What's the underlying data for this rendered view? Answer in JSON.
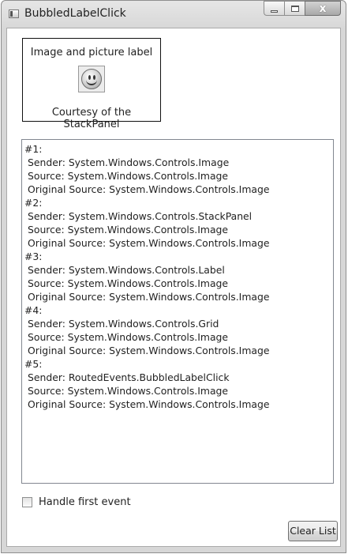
{
  "window": {
    "title": "BubbledLabelClick",
    "close_glyph": "x"
  },
  "label": {
    "top_text": "Image and picture label",
    "bottom_text": "Courtesy of the StackPanel",
    "image_icon": "smiley-face-icon"
  },
  "event_list": {
    "entries": [
      {
        "header": "#1:",
        "sender": "Sender: System.Windows.Controls.Image",
        "source": "Source: System.Windows.Controls.Image",
        "original_source": "Original Source: System.Windows.Controls.Image"
      },
      {
        "header": "#2:",
        "sender": "Sender: System.Windows.Controls.StackPanel",
        "source": "Source: System.Windows.Controls.Image",
        "original_source": "Original Source: System.Windows.Controls.Image"
      },
      {
        "header": "#3:",
        "sender": "Sender: System.Windows.Controls.Label",
        "source": "Source: System.Windows.Controls.Image",
        "original_source": "Original Source: System.Windows.Controls.Image"
      },
      {
        "header": "#4:",
        "sender": "Sender: System.Windows.Controls.Grid",
        "source": "Source: System.Windows.Controls.Image",
        "original_source": "Original Source: System.Windows.Controls.Image"
      },
      {
        "header": "#5:",
        "sender": "Sender: RoutedEvents.BubbledLabelClick",
        "source": "Source: System.Windows.Controls.Image",
        "original_source": "Original Source: System.Windows.Controls.Image"
      }
    ]
  },
  "options": {
    "handle_first_event_label": "Handle first event",
    "handle_first_event_checked": false
  },
  "buttons": {
    "clear_list_label": "Clear List"
  }
}
